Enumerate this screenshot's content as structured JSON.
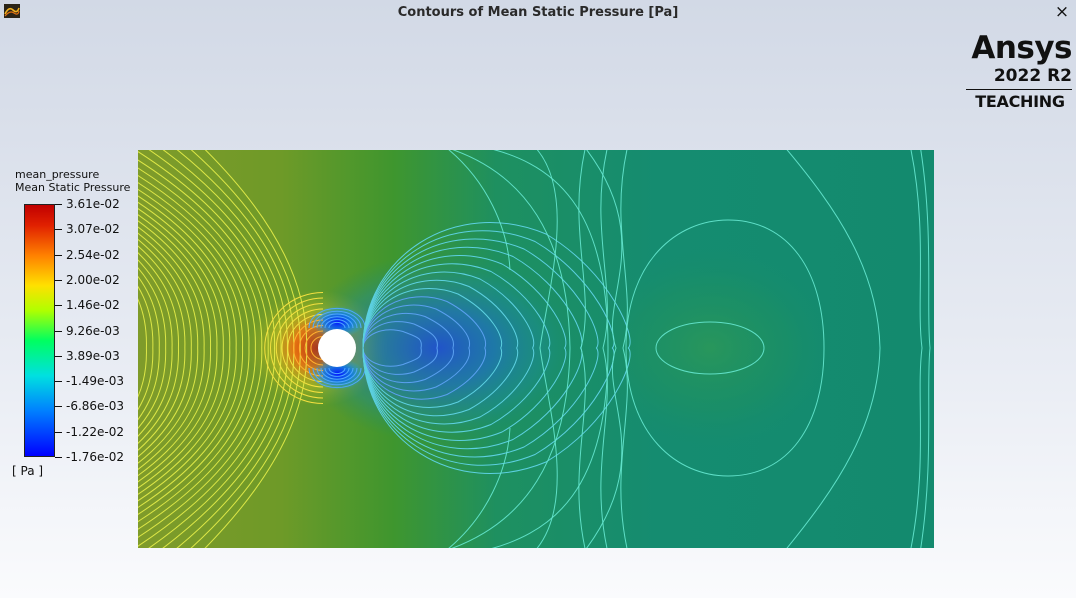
{
  "window": {
    "title": "Contours of Mean Static Pressure [Pa]",
    "close_symbol": "×"
  },
  "logo": {
    "brand": "Ansys",
    "version": "2022 R2",
    "edition": "TEACHING"
  },
  "legend": {
    "variable": "mean_pressure",
    "label": "Mean Static Pressure",
    "unit": "[ Pa ]",
    "ticks": [
      "3.61e-02",
      "3.07e-02",
      "2.54e-02",
      "2.00e-02",
      "1.46e-02",
      "9.26e-03",
      "3.89e-03",
      "-1.49e-03",
      "-6.86e-03",
      "-1.22e-02",
      "-1.76e-02"
    ],
    "min": -0.0176,
    "max": 0.0361
  },
  "icons": {
    "app": "fluent-app-icon",
    "close": "close-icon"
  },
  "colors": {
    "domain_upstream": "#7a9a2a",
    "domain_downstream": "#148c70",
    "contour_line_upstream": "#e7ef44",
    "contour_line_downstream": "#5fe8c8",
    "cylinder_fill": "#ffffff"
  }
}
